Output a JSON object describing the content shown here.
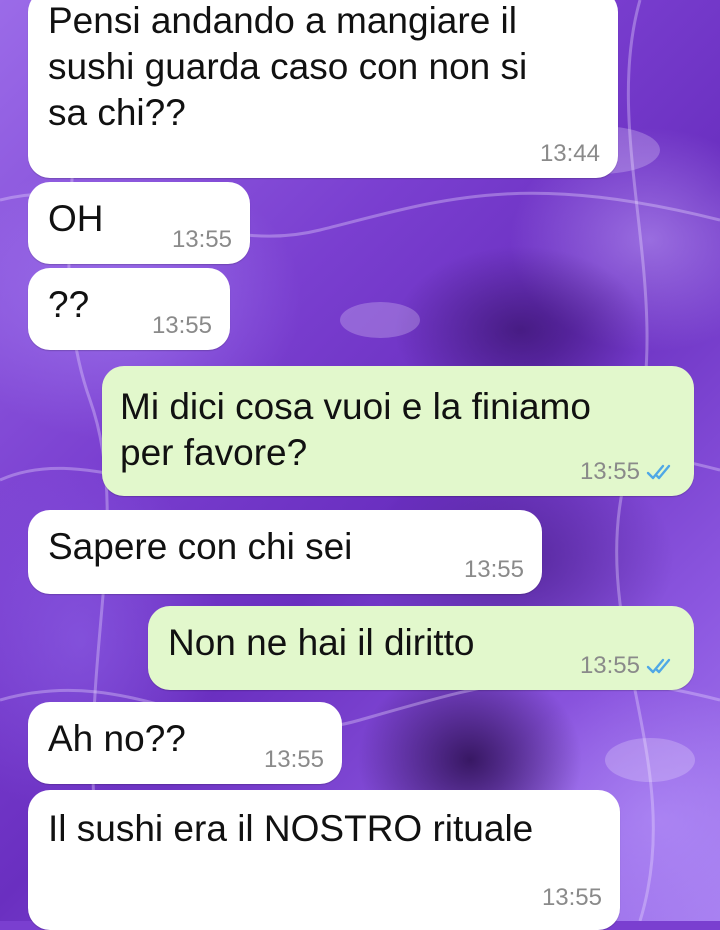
{
  "theme": {
    "incoming_bg": "#ffffff",
    "outgoing_bg": "#e2f8cc",
    "time_color": "#8a8a8a",
    "read_ticks_color": "#4fa8e6",
    "wallpaper_color": "#7a3fd0"
  },
  "messages": [
    {
      "direction": "incoming",
      "text": "Pensi andando a mangiare il\nsushi guarda caso con non si\nsa chi??",
      "time": "13:44"
    },
    {
      "direction": "incoming",
      "text": "OH",
      "time": "13:55"
    },
    {
      "direction": "incoming",
      "text": "??",
      "time": "13:55"
    },
    {
      "direction": "outgoing",
      "text": "Mi dici cosa vuoi e la finiamo\nper favore?",
      "time": "13:55",
      "status_icon": "double-check-read-icon"
    },
    {
      "direction": "incoming",
      "text": "Sapere con chi sei",
      "time": "13:55"
    },
    {
      "direction": "outgoing",
      "text": "Non ne hai il diritto",
      "time": "13:55",
      "status_icon": "double-check-read-icon"
    },
    {
      "direction": "incoming",
      "text": "Ah no??",
      "time": "13:55"
    },
    {
      "direction": "incoming",
      "text": "Il sushi era il NOSTRO rituale",
      "time": "13:55"
    }
  ]
}
